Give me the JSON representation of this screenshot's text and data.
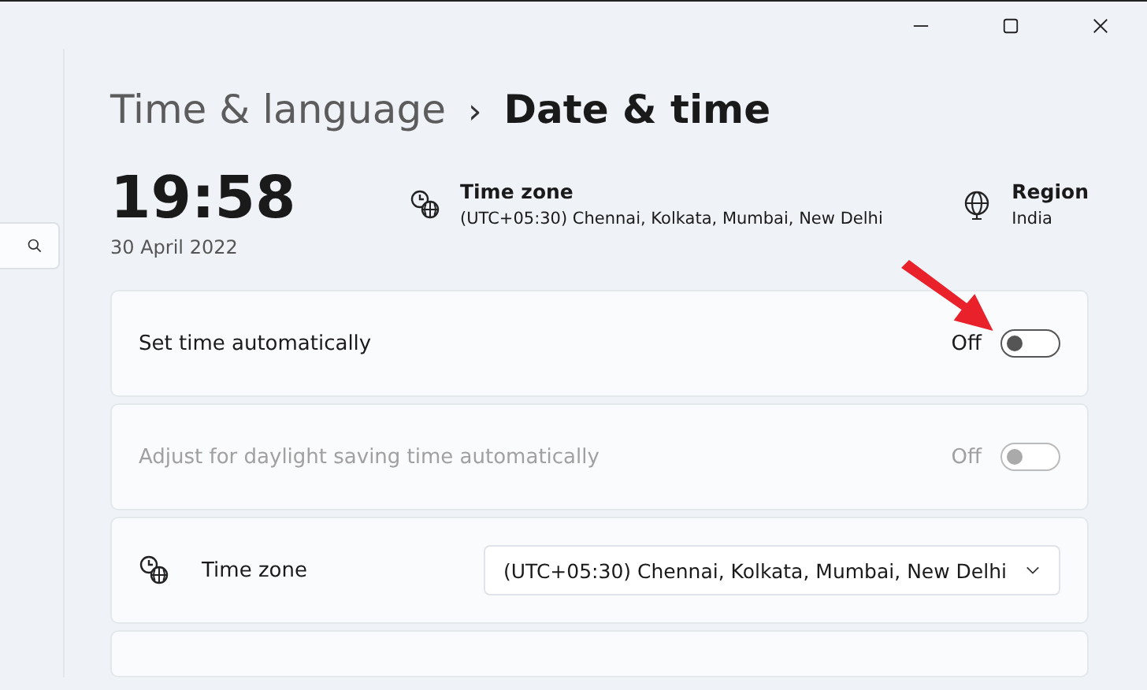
{
  "breadcrumb": {
    "parent": "Time & language",
    "separator": "›",
    "current": "Date & time"
  },
  "clock": {
    "time": "19:58",
    "date": "30 April 2022"
  },
  "info": [
    {
      "kind": "timezone",
      "title": "Time zone",
      "value": "(UTC+05:30) Chennai, Kolkata, Mumbai, New Delhi"
    },
    {
      "kind": "region",
      "title": "Region",
      "value": "India"
    }
  ],
  "settings": [
    {
      "kind": "toggle",
      "label": "Set time automatically",
      "state_text": "Off",
      "on": false,
      "disabled": false
    },
    {
      "kind": "toggle",
      "label": "Adjust for daylight saving time automatically",
      "state_text": "Off",
      "on": false,
      "disabled": true
    },
    {
      "kind": "dropdown",
      "label": "Time zone",
      "value": "(UTC+05:30) Chennai, Kolkata, Mumbai, New Delhi"
    }
  ]
}
